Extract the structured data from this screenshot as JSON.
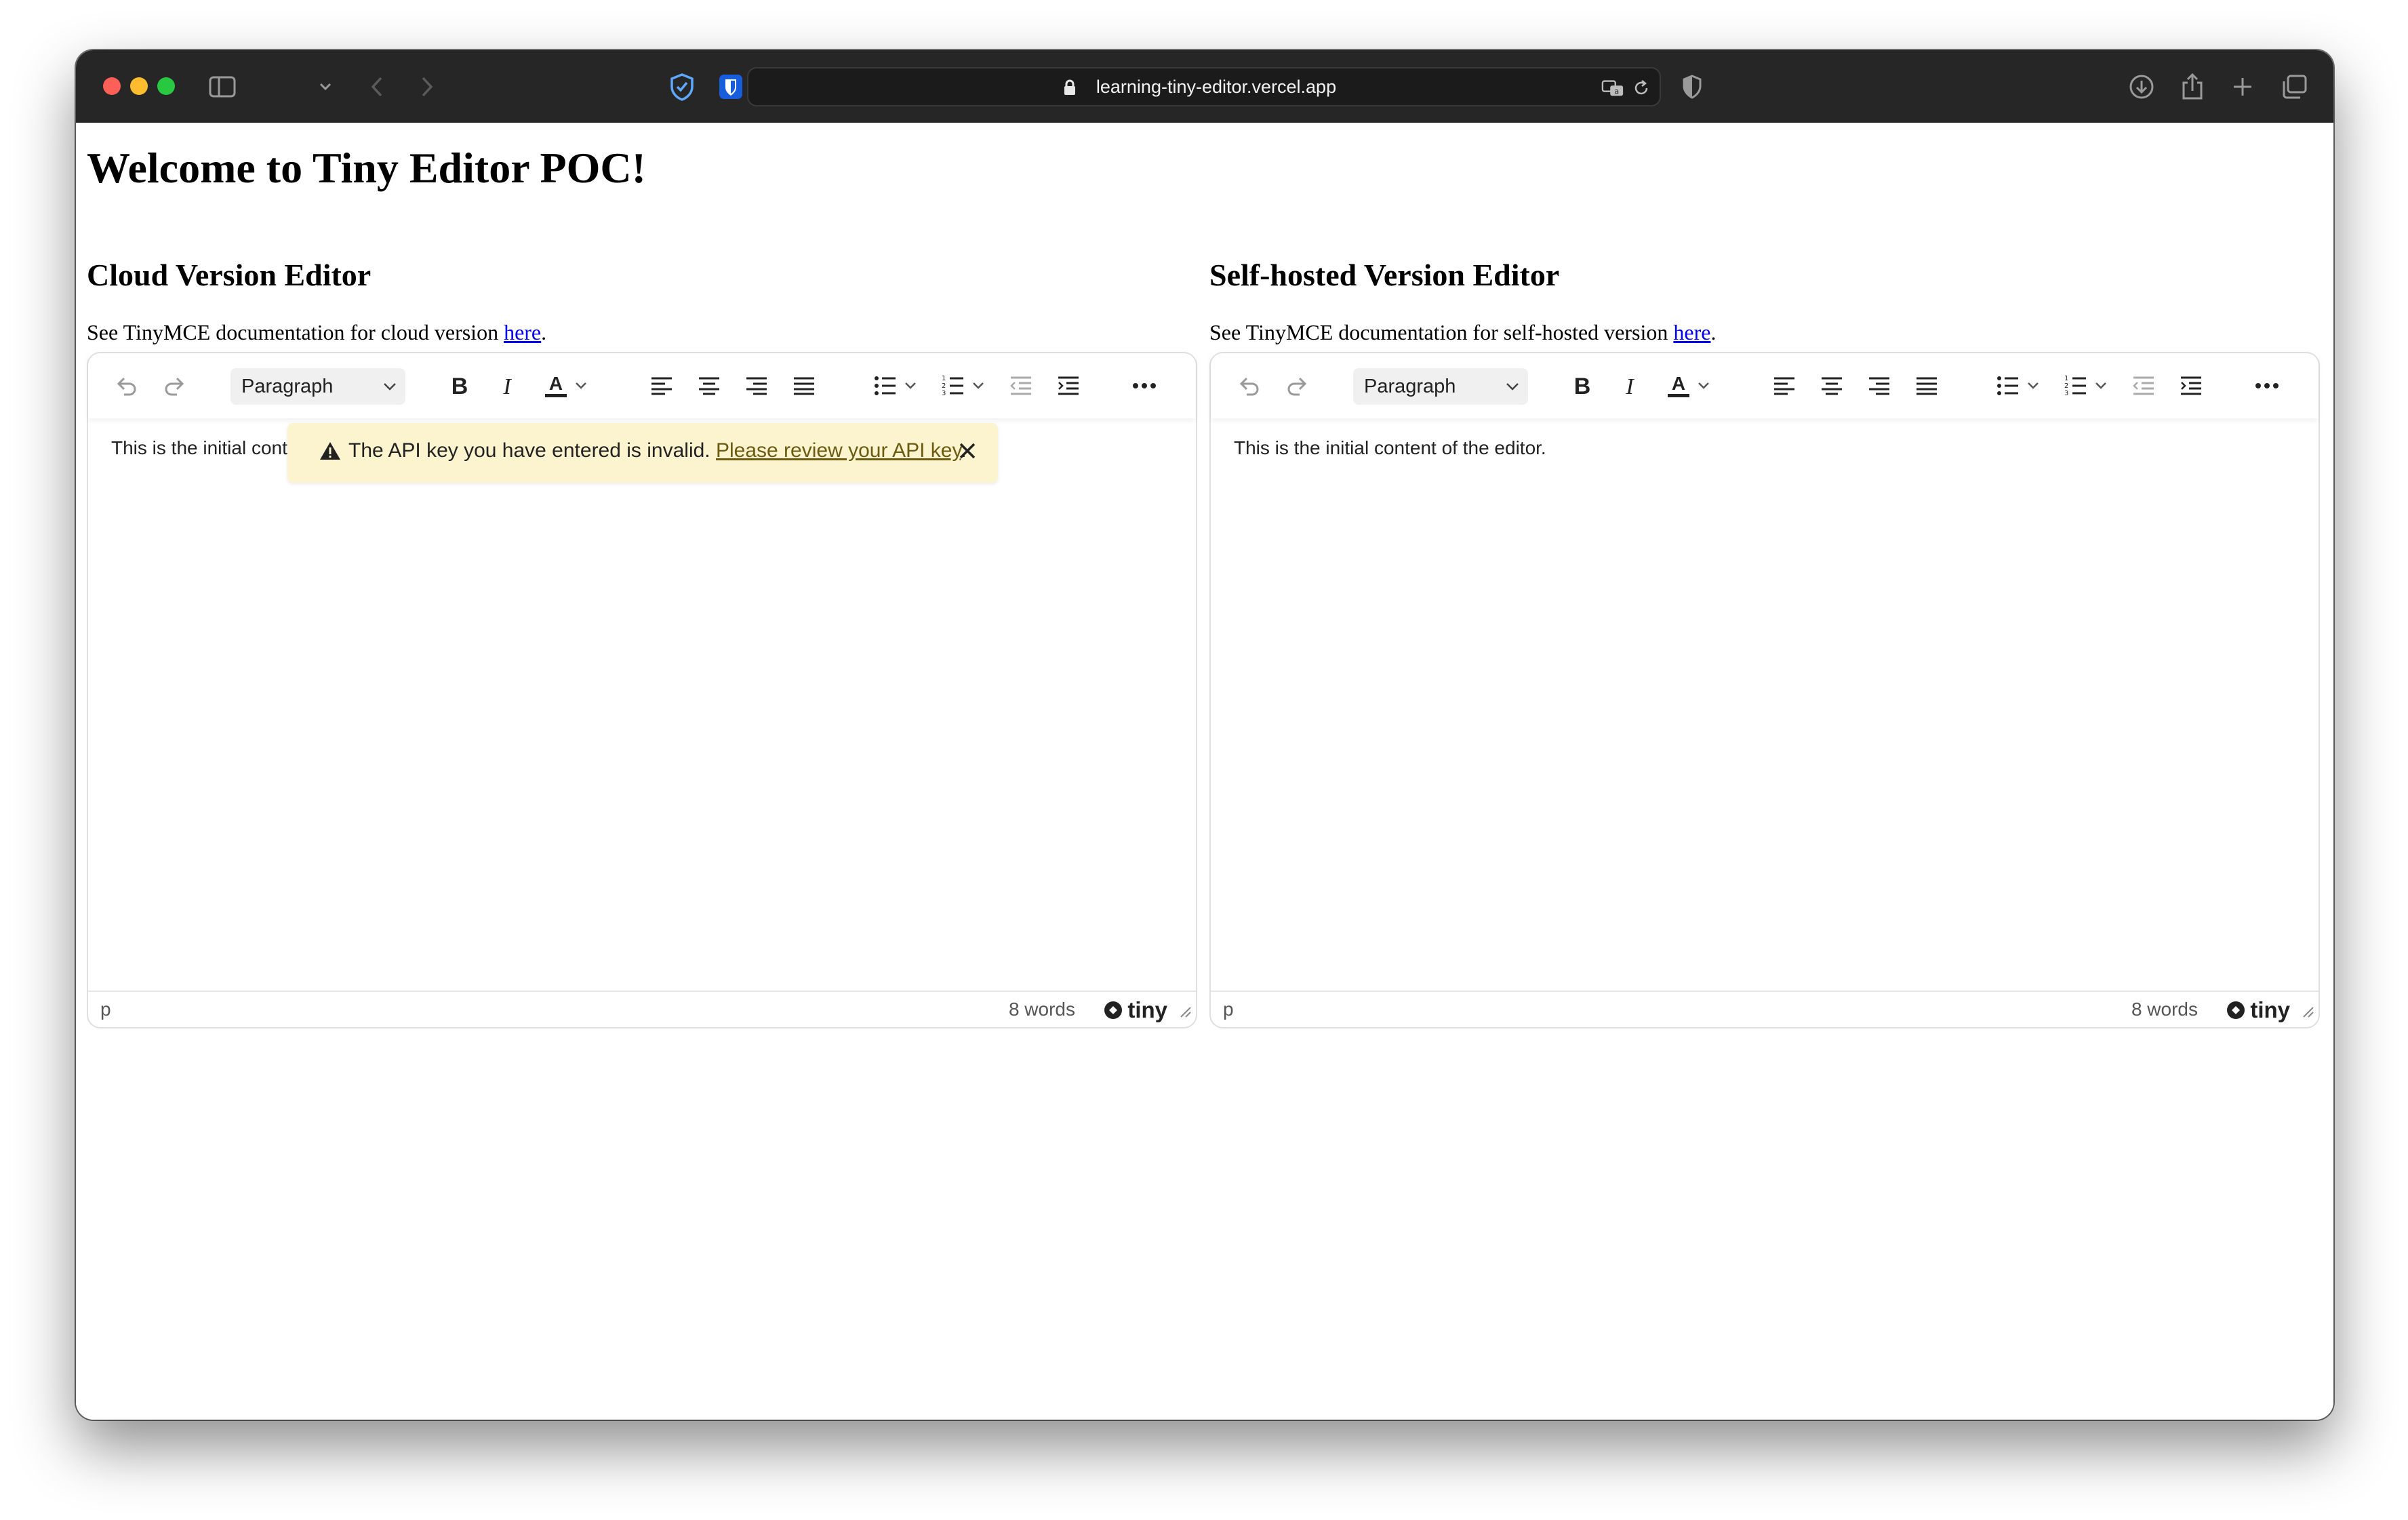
{
  "browser": {
    "url": "learning-tiny-editor.vercel.app"
  },
  "page": {
    "title": "Welcome to Tiny Editor POC!"
  },
  "editors": [
    {
      "heading": "Cloud Version Editor",
      "doc_prefix": "See TinyMCE documentation for cloud version ",
      "doc_link": "here",
      "doc_suffix": ".",
      "block_format": "Paragraph",
      "content": "This is the initial cont",
      "status_path": "p",
      "word_count": "8 words",
      "brand": "tiny",
      "notification": {
        "message": "The API key you have entered is invalid. ",
        "link": "Please review your API key",
        "suffix": "."
      }
    },
    {
      "heading": "Self-hosted Version Editor",
      "doc_prefix": "See TinyMCE documentation for self-hosted version ",
      "doc_link": "here",
      "doc_suffix": ".",
      "block_format": "Paragraph",
      "content": "This is the initial content of the editor.",
      "status_path": "p",
      "word_count": "8 words",
      "brand": "tiny"
    }
  ],
  "colors": {
    "titlebar": "#262626",
    "link": "#0000ee",
    "notification_bg": "#fcf3cf"
  },
  "toolbar_icons": [
    "undo-icon",
    "redo-icon",
    "bold-icon",
    "italic-icon",
    "text-color-icon",
    "align-left-icon",
    "align-center-icon",
    "align-right-icon",
    "justify-icon",
    "bullet-list-icon",
    "numbered-list-icon",
    "outdent-icon",
    "indent-icon",
    "more-icon"
  ]
}
